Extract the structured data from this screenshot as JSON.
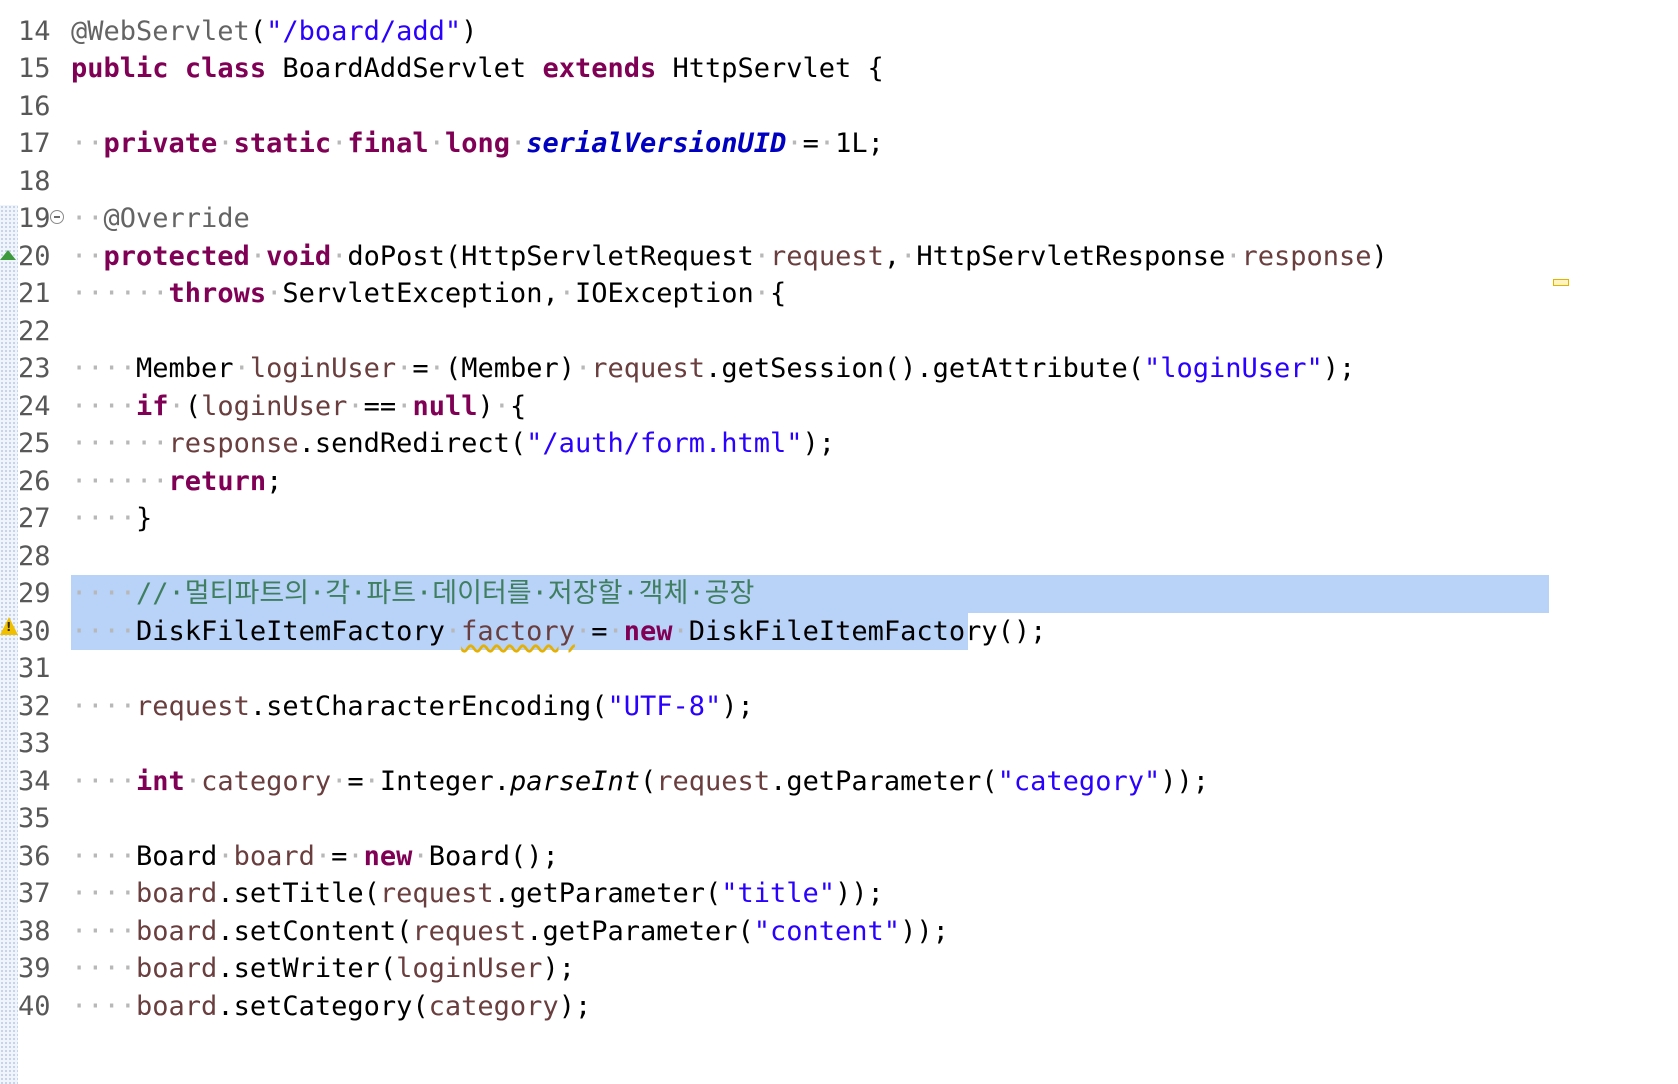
{
  "editor": {
    "first_line": 14,
    "lines": [
      [
        {
          "t": "@WebServlet",
          "c": "ann"
        },
        {
          "t": "("
        },
        {
          "t": "\"/board/add\"",
          "c": "str"
        },
        {
          "t": ")"
        }
      ],
      [
        {
          "t": "public",
          "c": "kw"
        },
        {
          "t": " "
        },
        {
          "t": "class",
          "c": "kw"
        },
        {
          "t": " BoardAddServlet "
        },
        {
          "t": "extends",
          "c": "kw"
        },
        {
          "t": " HttpServlet {"
        }
      ],
      [],
      [
        {
          "t": "··",
          "c": "sp"
        },
        {
          "t": "private",
          "c": "kw"
        },
        {
          "t": "·",
          "c": "sp"
        },
        {
          "t": "static",
          "c": "kw"
        },
        {
          "t": "·",
          "c": "sp"
        },
        {
          "t": "final",
          "c": "kw"
        },
        {
          "t": "·",
          "c": "sp"
        },
        {
          "t": "long",
          "c": "kw"
        },
        {
          "t": "·",
          "c": "sp"
        },
        {
          "t": "serialVersionUID",
          "c": "const"
        },
        {
          "t": "·",
          "c": "sp"
        },
        {
          "t": "="
        },
        {
          "t": "·",
          "c": "sp"
        },
        {
          "t": "1L;"
        }
      ],
      [],
      [
        {
          "t": "··",
          "c": "sp"
        },
        {
          "t": "@Override",
          "c": "ann"
        }
      ],
      [
        {
          "t": "··",
          "c": "sp"
        },
        {
          "t": "protected",
          "c": "kw"
        },
        {
          "t": "·",
          "c": "sp"
        },
        {
          "t": "void",
          "c": "kw"
        },
        {
          "t": "·",
          "c": "sp"
        },
        {
          "t": "doPost(HttpServletRequest"
        },
        {
          "t": "·",
          "c": "sp"
        },
        {
          "t": "request",
          "c": "var"
        },
        {
          "t": ","
        },
        {
          "t": "·",
          "c": "sp"
        },
        {
          "t": "HttpServletResponse"
        },
        {
          "t": "·",
          "c": "sp"
        },
        {
          "t": "response",
          "c": "var"
        },
        {
          "t": ")"
        }
      ],
      [
        {
          "t": "······",
          "c": "sp"
        },
        {
          "t": "throws",
          "c": "kw"
        },
        {
          "t": "·",
          "c": "sp"
        },
        {
          "t": "ServletException,"
        },
        {
          "t": "·",
          "c": "sp"
        },
        {
          "t": "IOException"
        },
        {
          "t": "·",
          "c": "sp"
        },
        {
          "t": "{"
        }
      ],
      [],
      [
        {
          "t": "····",
          "c": "sp"
        },
        {
          "t": "Member"
        },
        {
          "t": "·",
          "c": "sp"
        },
        {
          "t": "loginUser",
          "c": "var"
        },
        {
          "t": "·",
          "c": "sp"
        },
        {
          "t": "="
        },
        {
          "t": "·",
          "c": "sp"
        },
        {
          "t": "(Member)"
        },
        {
          "t": "·",
          "c": "sp"
        },
        {
          "t": "request",
          "c": "var"
        },
        {
          "t": ".getSession().getAttribute("
        },
        {
          "t": "\"loginUser\"",
          "c": "str"
        },
        {
          "t": ");"
        }
      ],
      [
        {
          "t": "····",
          "c": "sp"
        },
        {
          "t": "if",
          "c": "kw"
        },
        {
          "t": "·",
          "c": "sp"
        },
        {
          "t": "("
        },
        {
          "t": "loginUser",
          "c": "var"
        },
        {
          "t": "·",
          "c": "sp"
        },
        {
          "t": "=="
        },
        {
          "t": "·",
          "c": "sp"
        },
        {
          "t": "null",
          "c": "kw"
        },
        {
          "t": ")"
        },
        {
          "t": "·",
          "c": "sp"
        },
        {
          "t": "{"
        }
      ],
      [
        {
          "t": "······",
          "c": "sp"
        },
        {
          "t": "response",
          "c": "var"
        },
        {
          "t": ".sendRedirect("
        },
        {
          "t": "\"/auth/form.html\"",
          "c": "str"
        },
        {
          "t": ");"
        }
      ],
      [
        {
          "t": "······",
          "c": "sp"
        },
        {
          "t": "return",
          "c": "kw"
        },
        {
          "t": ";"
        }
      ],
      [
        {
          "t": "····",
          "c": "sp"
        },
        {
          "t": "}"
        }
      ],
      [],
      [
        {
          "t": "····",
          "c": "sp"
        },
        {
          "t": "//·멀티파트의·각·파트·데이터를·저장할·객체·공장",
          "c": "cm"
        }
      ],
      [
        {
          "t": "····",
          "c": "sp"
        },
        {
          "t": "DiskFileItemFactory"
        },
        {
          "t": "·",
          "c": "sp"
        },
        {
          "t": "factory",
          "c": "var warn-u"
        },
        {
          "t": "·",
          "c": "sp"
        },
        {
          "t": "="
        },
        {
          "t": "·",
          "c": "sp"
        },
        {
          "t": "new",
          "c": "kw"
        },
        {
          "t": "·",
          "c": "sp"
        },
        {
          "t": "DiskFileItemFactory();"
        }
      ],
      [],
      [
        {
          "t": "····",
          "c": "sp"
        },
        {
          "t": "request",
          "c": "var"
        },
        {
          "t": ".setCharacterEncoding("
        },
        {
          "t": "\"UTF-8\"",
          "c": "str"
        },
        {
          "t": ");"
        }
      ],
      [],
      [
        {
          "t": "····",
          "c": "sp"
        },
        {
          "t": "int",
          "c": "kw"
        },
        {
          "t": "·",
          "c": "sp"
        },
        {
          "t": "category",
          "c": "var"
        },
        {
          "t": "·",
          "c": "sp"
        },
        {
          "t": "="
        },
        {
          "t": "·",
          "c": "sp"
        },
        {
          "t": "Integer."
        },
        {
          "t": "parseInt",
          "c": "static-call"
        },
        {
          "t": "("
        },
        {
          "t": "request",
          "c": "var"
        },
        {
          "t": ".getParameter("
        },
        {
          "t": "\"category\"",
          "c": "str"
        },
        {
          "t": "));"
        }
      ],
      [],
      [
        {
          "t": "····",
          "c": "sp"
        },
        {
          "t": "Board"
        },
        {
          "t": "·",
          "c": "sp"
        },
        {
          "t": "board",
          "c": "var"
        },
        {
          "t": "·",
          "c": "sp"
        },
        {
          "t": "="
        },
        {
          "t": "·",
          "c": "sp"
        },
        {
          "t": "new",
          "c": "kw"
        },
        {
          "t": "·",
          "c": "sp"
        },
        {
          "t": "Board();"
        }
      ],
      [
        {
          "t": "····",
          "c": "sp"
        },
        {
          "t": "board",
          "c": "var"
        },
        {
          "t": ".setTitle("
        },
        {
          "t": "request",
          "c": "var"
        },
        {
          "t": ".getParameter("
        },
        {
          "t": "\"title\"",
          "c": "str"
        },
        {
          "t": "));"
        }
      ],
      [
        {
          "t": "····",
          "c": "sp"
        },
        {
          "t": "board",
          "c": "var"
        },
        {
          "t": ".setContent("
        },
        {
          "t": "request",
          "c": "var"
        },
        {
          "t": ".getParameter("
        },
        {
          "t": "\"content\"",
          "c": "str"
        },
        {
          "t": "));"
        }
      ],
      [
        {
          "t": "····",
          "c": "sp"
        },
        {
          "t": "board",
          "c": "var"
        },
        {
          "t": ".setWriter("
        },
        {
          "t": "loginUser",
          "c": "var"
        },
        {
          "t": ");"
        }
      ],
      [
        {
          "t": "····",
          "c": "sp"
        },
        {
          "t": "board",
          "c": "var"
        },
        {
          "t": ".setCategory("
        },
        {
          "t": "category",
          "c": "var"
        },
        {
          "t": ");"
        }
      ]
    ]
  },
  "icons": {
    "fold": "collapse-minus-icon",
    "override": "override-triangle-icon",
    "warning": "warning-icon",
    "overview": "overview-ruler-marker"
  },
  "colors": {
    "keyword": "#7f0055",
    "string": "#2a00ff",
    "variable": "#6a3e3e",
    "comment": "#3f7f5f",
    "annotation": "#646464",
    "constant": "#0000c0",
    "selection": "#b8d2f8",
    "whitespace": "#b8b8b8",
    "line_number": "#585858"
  }
}
